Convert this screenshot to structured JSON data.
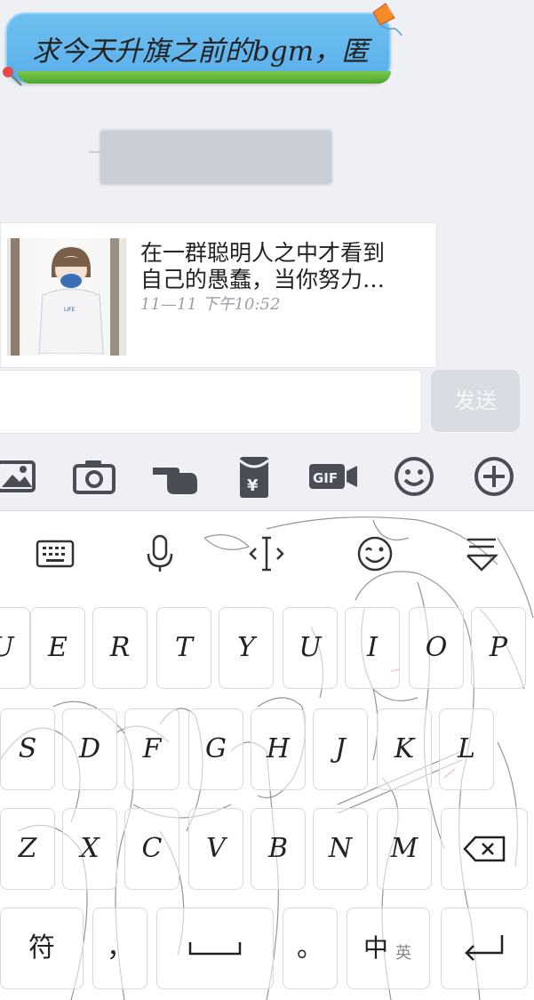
{
  "chat": {
    "bubble_text": "求今天升旗之前的bgm，匿",
    "shared_card": {
      "title_line1": "在一群聪明人之中才看到",
      "title_line2": "自己的愚蠢，当你努力…",
      "time": "11—11  下午10:52"
    }
  },
  "input": {
    "placeholder": "",
    "send_label": "发送"
  },
  "toolbar": {
    "icons": [
      "image-icon",
      "camera-icon",
      "poke-hand-icon",
      "red-packet-icon",
      "gif-icon",
      "emoji-icon",
      "plus-icon"
    ]
  },
  "keyboard": {
    "top_icons": [
      "keyboard-icon",
      "microphone-icon",
      "cursor-icon",
      "emoji-icon",
      "hide-keyboard-icon"
    ],
    "row1": [
      "U",
      "E",
      "R",
      "T",
      "Y",
      "U",
      "I",
      "O",
      "P"
    ],
    "row2": [
      "S",
      "D",
      "F",
      "G",
      "H",
      "J",
      "K",
      "L"
    ],
    "row3": [
      "Z",
      "X",
      "C",
      "V",
      "B",
      "N",
      "M"
    ],
    "bottom": {
      "symbols": "符",
      "comma": "，",
      "period": "。",
      "lang_main": "中",
      "lang_alt": "英"
    }
  }
}
